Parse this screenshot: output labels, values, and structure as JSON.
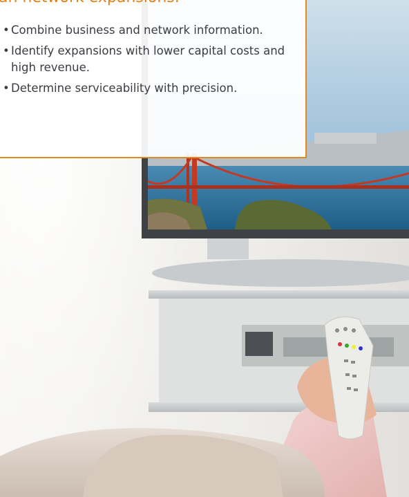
{
  "callout": {
    "heading": "an network expansions.",
    "items": [
      "Combine business and network information.",
      "Identify expansions with lower capital costs and high revenue.",
      "Determine serviceability with precision."
    ],
    "bullet": "•"
  },
  "colors": {
    "accent": "#e48a1c",
    "text": "#3a3c42",
    "wall": "#f1f0ec",
    "sky": "#8fb8d8",
    "water": "#2a6f9a",
    "bridge": "#c23a24",
    "remote": "#e9e9e6",
    "sleeve": "#efc8c6",
    "sofa": "#ddd2c8"
  },
  "photo": {
    "subjects": [
      "flat-screen-tv",
      "golden-gate-bridge-on-screen",
      "tv-remote",
      "hand",
      "sofa",
      "tv-stand"
    ]
  }
}
